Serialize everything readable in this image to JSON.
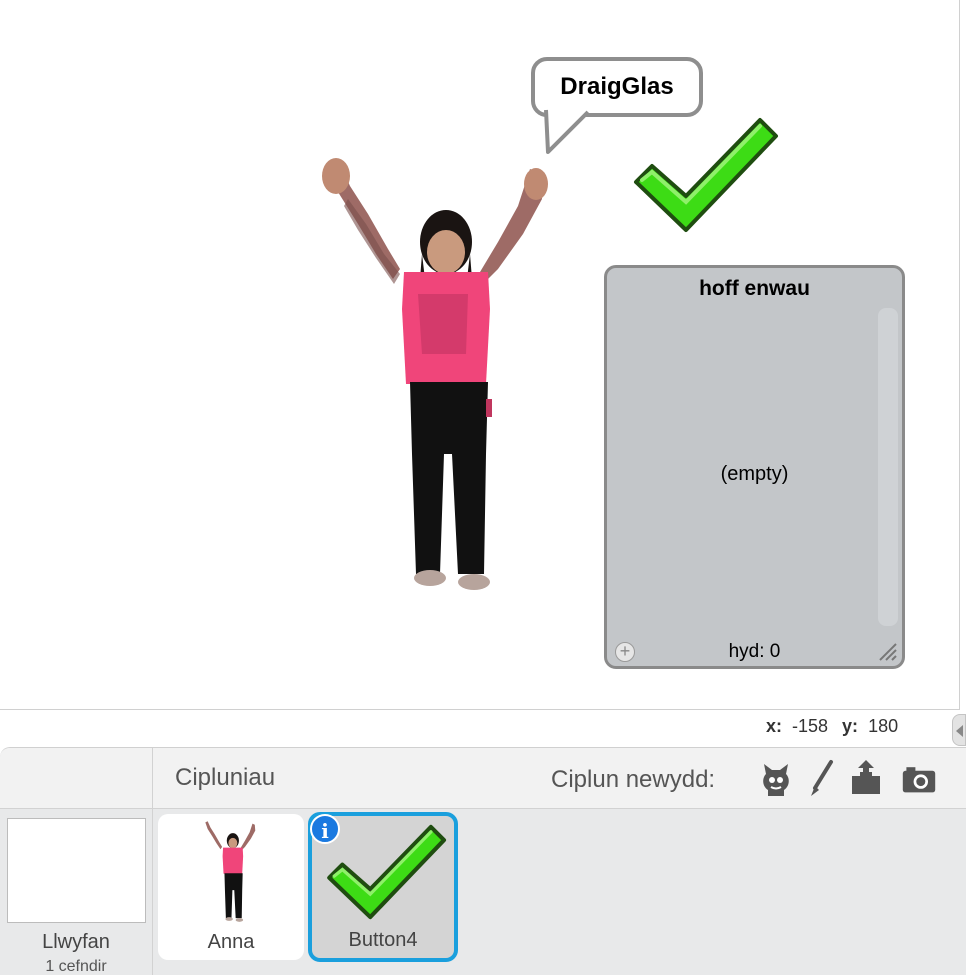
{
  "stage": {
    "speech_bubble": "DraigGlas",
    "list_monitor": {
      "title": "hoff enwau",
      "empty_text": "(empty)",
      "length_label": "hyd: 0"
    }
  },
  "coordinates": {
    "x_label": "x:",
    "x_value": "-158",
    "y_label": "y:",
    "y_value": "180"
  },
  "sprite_pane": {
    "title": "Cipluniau",
    "new_sprite_label": "Ciplun newydd:",
    "tools": [
      "sprite-library-icon",
      "paint-brush-icon",
      "upload-icon",
      "camera-icon"
    ],
    "stage": {
      "label": "Llwyfan",
      "sublabel": "1 cefndir"
    },
    "sprites": [
      {
        "name": "Anna",
        "selected": false
      },
      {
        "name": "Button4",
        "selected": true,
        "badge": "i"
      }
    ]
  },
  "colors": {
    "checkmark_green": "#3ddc15",
    "selection_blue": "#1a9fdd",
    "list_bg": "#c3c6c9"
  }
}
